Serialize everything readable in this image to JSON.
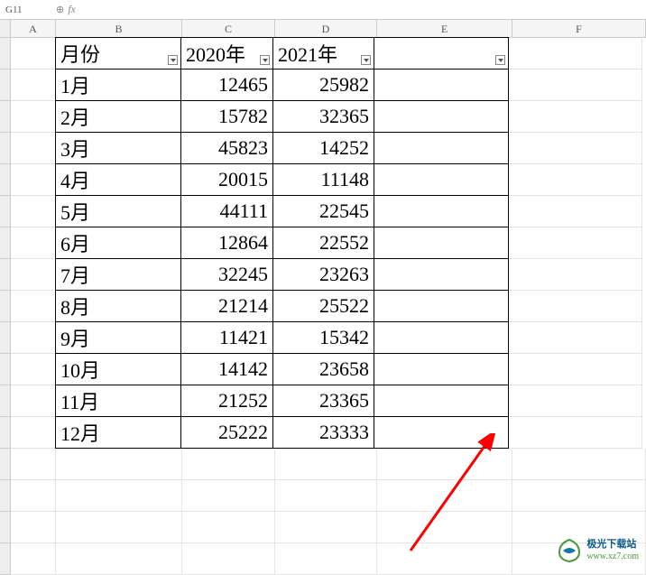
{
  "formula_bar": {
    "cell_ref": "G11",
    "fx_label": "fx"
  },
  "columns": [
    "A",
    "B",
    "C",
    "D",
    "E",
    "F"
  ],
  "headers": {
    "month": "月份",
    "year1": "2020年",
    "year2": "2021年"
  },
  "chart_data": {
    "type": "table",
    "title": "",
    "columns": [
      "月份",
      "2020年",
      "2021年"
    ],
    "rows": [
      {
        "month": "1月",
        "y2020": 12465,
        "y2021": 25982
      },
      {
        "month": "2月",
        "y2020": 15782,
        "y2021": 32365
      },
      {
        "month": "3月",
        "y2020": 45823,
        "y2021": 14252
      },
      {
        "month": "4月",
        "y2020": 20015,
        "y2021": 11148
      },
      {
        "month": "5月",
        "y2020": 44111,
        "y2021": 22545
      },
      {
        "month": "6月",
        "y2020": 12864,
        "y2021": 22552
      },
      {
        "month": "7月",
        "y2020": 32245,
        "y2021": 23263
      },
      {
        "month": "8月",
        "y2020": 21214,
        "y2021": 25522
      },
      {
        "month": "9月",
        "y2020": 11421,
        "y2021": 15342
      },
      {
        "month": "10月",
        "y2020": 14142,
        "y2021": 23658
      },
      {
        "month": "11月",
        "y2020": 21252,
        "y2021": 23365
      },
      {
        "month": "12月",
        "y2020": 25222,
        "y2021": 23333
      }
    ]
  },
  "watermark": {
    "title": "极光下载站",
    "url": "www.xz7.com"
  }
}
